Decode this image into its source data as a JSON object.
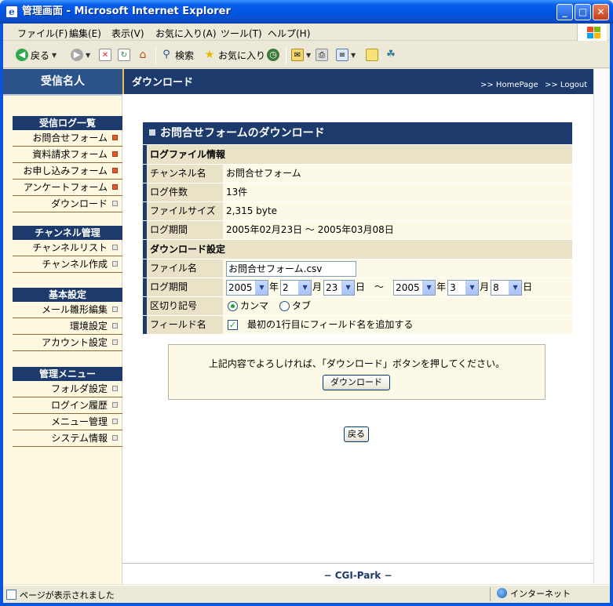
{
  "window": {
    "title": "管理画面 - Microsoft Internet Explorer",
    "icon": "ie-page-icon",
    "buttons": [
      "minimize",
      "maximize",
      "close"
    ]
  },
  "menubar": {
    "items": [
      "ファイル(F)",
      "編集(E)",
      "表示(V)",
      "お気に入り(A)",
      "ツール(T)",
      "ヘルプ(H)"
    ]
  },
  "toolbar": {
    "back_label": "戻る",
    "search_label": "検索",
    "favorites_label": "お気に入り"
  },
  "header": {
    "brand": "受信名人",
    "page_title": "ダウンロード",
    "links": [
      ">> HomePage",
      ">> Logout"
    ]
  },
  "sidebar": {
    "sections": [
      {
        "title": "受信ログ一覧",
        "items": [
          {
            "label": "お問合せフォーム",
            "bullet": "red"
          },
          {
            "label": "資料請求フォーム",
            "bullet": "red"
          },
          {
            "label": "お申し込みフォーム",
            "bullet": "red"
          },
          {
            "label": "アンケートフォーム",
            "bullet": "red"
          },
          {
            "label": "ダウンロード",
            "bullet": "gray"
          }
        ]
      },
      {
        "title": "チャンネル管理",
        "items": [
          {
            "label": "チャンネルリスト",
            "bullet": "gray"
          },
          {
            "label": "チャンネル作成",
            "bullet": "gray"
          }
        ]
      },
      {
        "title": "基本設定",
        "items": [
          {
            "label": "メール雛形編集",
            "bullet": "gray"
          },
          {
            "label": "環境設定",
            "bullet": "gray"
          },
          {
            "label": "アカウント設定",
            "bullet": "gray"
          }
        ]
      },
      {
        "title": "管理メニュー",
        "items": [
          {
            "label": "フォルダ設定",
            "bullet": "gray"
          },
          {
            "label": "ログイン履歴",
            "bullet": "gray"
          },
          {
            "label": "メニュー管理",
            "bullet": "gray"
          },
          {
            "label": "システム情報",
            "bullet": "gray"
          }
        ]
      }
    ]
  },
  "form": {
    "title": "お問合せフォームのダウンロード",
    "log_info": {
      "heading": "ログファイル情報",
      "channel_label": "チャンネル名",
      "channel_value": "お問合せフォーム",
      "count_label": "ログ件数",
      "count_value": "13件",
      "size_label": "ファイルサイズ",
      "size_value": "2,315 byte",
      "period_label": "ログ期間",
      "period_value": "2005年02月23日 〜 2005年03月08日"
    },
    "download": {
      "heading": "ダウンロード設定",
      "filename_label": "ファイル名",
      "filename_value": "お問合せフォーム.csv",
      "period_label": "ログ期間",
      "from_year": "2005",
      "from_month": "2",
      "from_day": "23",
      "to_year": "2005",
      "to_month": "3",
      "to_day": "8",
      "unit_year": "年",
      "unit_month": "月",
      "unit_day": "日",
      "range_sep": "〜",
      "delimiter_label": "区切り記号",
      "delimiter_options": [
        "カンマ",
        "タブ"
      ],
      "delimiter_selected": "カンマ",
      "fieldname_label": "フィールド名",
      "fieldname_option": "最初の1行目にフィールド名を追加する",
      "fieldname_checked": true
    },
    "notice": "上記内容でよろしければ、「ダウンロード」ボタンを押してください。",
    "download_button": "ダウンロード",
    "back_button": "戻る"
  },
  "footer": {
    "text": "− CGI-Park −"
  },
  "statusbar": {
    "message": "ページが表示されました",
    "zone": "インターネット"
  },
  "colors": {
    "title_blue": "#0054e3",
    "nav_dark": "#1c3a6b",
    "label_bg": "#e9e2c6",
    "value_bg": "#fcf9e6",
    "sidebar_bg": "#fdf8df",
    "bullet_red": "#e05a2a"
  }
}
